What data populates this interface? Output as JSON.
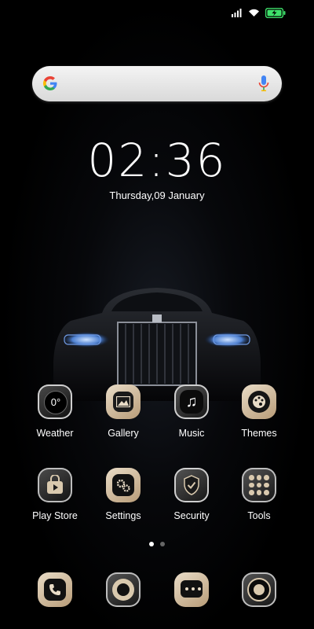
{
  "status_bar": {
    "icons": [
      "signal-icon",
      "wifi-icon",
      "battery-charging-icon"
    ],
    "accent": "#3ee06a"
  },
  "search": {
    "left_icon": "google-g-icon",
    "right_icon": "mic-icon"
  },
  "clock": {
    "time": "02:36",
    "date": "Thursday,09 January"
  },
  "apps": [
    {
      "label": "Weather",
      "icon": "weather-icon",
      "glyph": "0°"
    },
    {
      "label": "Gallery",
      "icon": "gallery-icon"
    },
    {
      "label": "Music",
      "icon": "music-icon",
      "glyph": "♫"
    },
    {
      "label": "Themes",
      "icon": "palette-icon"
    },
    {
      "label": "Play Store",
      "icon": "play-store-icon"
    },
    {
      "label": "Settings",
      "icon": "settings-icon"
    },
    {
      "label": "Security",
      "icon": "shield-icon"
    },
    {
      "label": "Tools",
      "icon": "tools-grid-icon"
    }
  ],
  "dock": [
    {
      "icon": "phone-icon"
    },
    {
      "icon": "camera-lens-icon"
    },
    {
      "icon": "messages-icon"
    },
    {
      "icon": "browser-icon"
    }
  ],
  "pager": {
    "pages": 2,
    "current": 1
  }
}
